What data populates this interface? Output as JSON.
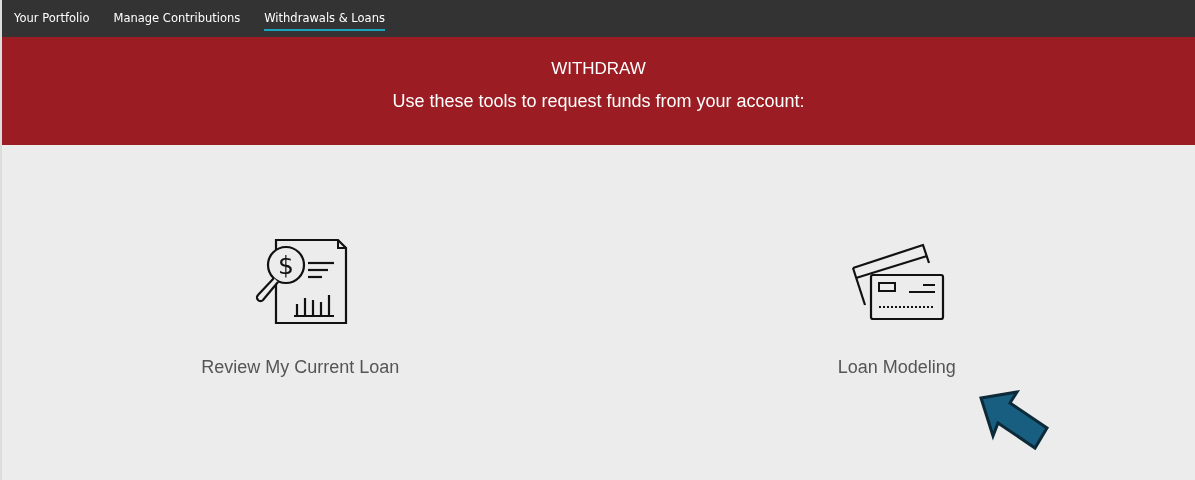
{
  "nav": {
    "tabs": [
      {
        "label": "Your Portfolio",
        "selected": false
      },
      {
        "label": "Manage Contributions",
        "selected": false
      },
      {
        "label": "Withdrawals & Loans",
        "selected": true
      }
    ]
  },
  "banner": {
    "title": "WITHDRAW",
    "subtitle": "Use these tools to request funds from your account:"
  },
  "tools": [
    {
      "kind": "report",
      "label": "Review My Current Loan",
      "symbol": "$"
    },
    {
      "kind": "cards",
      "label": "Loan Modeling"
    }
  ]
}
